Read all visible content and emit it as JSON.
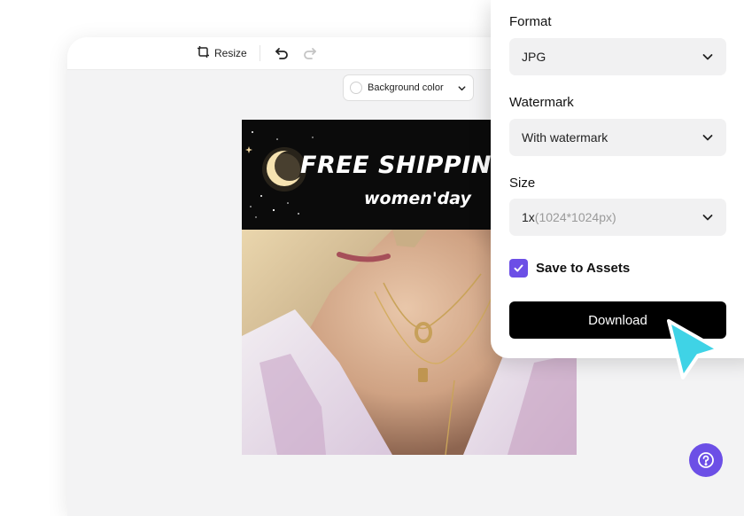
{
  "toolbar": {
    "resize_label": "Resize",
    "background_color_label": "Background color"
  },
  "poster": {
    "headline": "FREE SHIPPIN",
    "subline": "women'day"
  },
  "export_panel": {
    "format": {
      "label": "Format",
      "value": "JPG"
    },
    "watermark": {
      "label": "Watermark",
      "value": "With watermark"
    },
    "size": {
      "label": "Size",
      "scale": "1x",
      "dimensions": "(1024*1024px)"
    },
    "save_to_assets": {
      "label": "Save to Assets",
      "checked": true
    },
    "download_label": "Download"
  },
  "colors": {
    "accent": "#6c4fe6",
    "cursor": "#3fd3e6",
    "download_bg": "#000000"
  },
  "icons": {
    "resize": "resize-icon",
    "undo": "undo-icon",
    "redo": "redo-icon",
    "chevron": "chevron-down-icon",
    "check": "check-icon",
    "help": "help-icon",
    "cursor": "pointer-cursor-icon"
  }
}
